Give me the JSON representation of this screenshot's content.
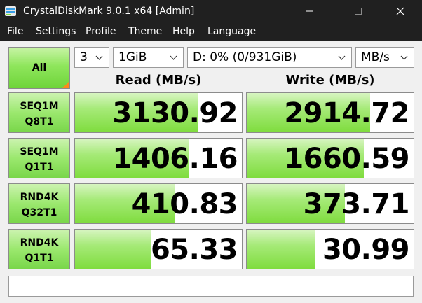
{
  "window": {
    "title": "CrystalDiskMark 9.0.1 x64 [Admin]"
  },
  "menu": [
    "File",
    "Settings",
    "Profile",
    "Theme",
    "Help",
    "Language"
  ],
  "controls": {
    "all_label": "All",
    "count": "3",
    "size": "1GiB",
    "drive": "D: 0% (0/931GiB)",
    "unit": "MB/s"
  },
  "headers": {
    "read": "Read (MB/s)",
    "write": "Write (MB/s)"
  },
  "results": [
    {
      "line1": "SEQ1M",
      "line2": "Q8T1",
      "read": "3130.92",
      "write": "2914.72",
      "read_fill": 0.74,
      "write_fill": 0.74
    },
    {
      "line1": "SEQ1M",
      "line2": "Q1T1",
      "read": "1406.16",
      "write": "1660.59",
      "read_fill": 0.68,
      "write_fill": 0.7
    },
    {
      "line1": "RND4K",
      "line2": "Q32T1",
      "read": "410.83",
      "write": "373.71",
      "read_fill": 0.6,
      "write_fill": 0.59
    },
    {
      "line1": "RND4K",
      "line2": "Q1T1",
      "read": "65.33",
      "write": "30.99",
      "read_fill": 0.46,
      "write_fill": 0.41
    }
  ],
  "status": "",
  "colors": {
    "titlebar": "#202020",
    "accent_green": "#7fdc3e",
    "corner_orange": "#ff8a1a"
  },
  "icons": {
    "app": "crystaldiskmark-icon",
    "minimize": "minimize-icon",
    "maximize": "maximize-icon",
    "close": "close-icon",
    "dropdown": "chevron-down-icon"
  }
}
